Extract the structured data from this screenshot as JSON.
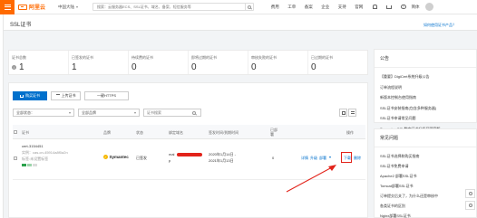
{
  "topbar": {
    "logo_text": "阿里云",
    "region": "中国大陆",
    "search_placeholder": "搜索：云服务器ECS、SSL证书、域名、备案、短信服务等",
    "nav": [
      "费用",
      "工单",
      "备案",
      "企业",
      "支持",
      "官网"
    ],
    "lang": "简体"
  },
  "page": {
    "title": "SSL证书",
    "doc_link": "如何使用证书产品？"
  },
  "stats": [
    {
      "label": "证书总数",
      "value": "1"
    },
    {
      "label": "已签发的证书",
      "value": "1"
    },
    {
      "label": "待续费的证书",
      "value": "0"
    },
    {
      "label": "即将过期的证书",
      "value": "0"
    },
    {
      "label": "审核失败的证书",
      "value": "0"
    },
    {
      "label": "已过期的证书",
      "value": "0"
    }
  ],
  "toolbar": {
    "buy_label": "购买证书",
    "upload_label": "上传证书",
    "https_label": "一键HTTPS"
  },
  "filters": {
    "status": "全部状态：",
    "brand": "全部品牌",
    "search_placeholder": "证书搜索"
  },
  "table": {
    "headers": {
      "cert": "证书",
      "brand": "品牌",
      "status": "状态",
      "domain": "绑定域名",
      "validity": "签发时间/到期时间",
      "deployed": "已部署",
      "actions": "操作"
    },
    "row": {
      "cert_name": "cert-3154451",
      "cert_instance": "实例：cas-cn-45914a8f0a2n",
      "cert_tag": "标签:未设置标签",
      "brand": "Symantec",
      "status": "已签发",
      "domain_prefix": "mai",
      "domain_suffix": "p",
      "issued": "2020年1月14日 -",
      "expires": "2021年1月13日",
      "deployed": "0",
      "actions": {
        "details": "详情",
        "upgrade": "升级",
        "deploy": "部署",
        "download": "下载",
        "delete": "删除"
      }
    }
  },
  "announcements": {
    "title": "公告",
    "items": [
      "【重要】DigiCert系统升级公告",
      "订单流程说明",
      "新版本控制台使用指南",
      "SSL证书安装指南(包含多种服务器)",
      "SSL证书申请常见问题",
      "Symantec SSL数字证书升级至国密版"
    ]
  },
  "faq": {
    "title": "常见问题",
    "items": [
      "SSL证书选择和购买指南",
      "SSL证书免费申请",
      "Apache2 部署SSL证书",
      "Tomcat部署SSL证书",
      "订单提交后关了，为什么还是审核中",
      "各类证书的区别",
      "Nginx部署SSL证书"
    ]
  }
}
